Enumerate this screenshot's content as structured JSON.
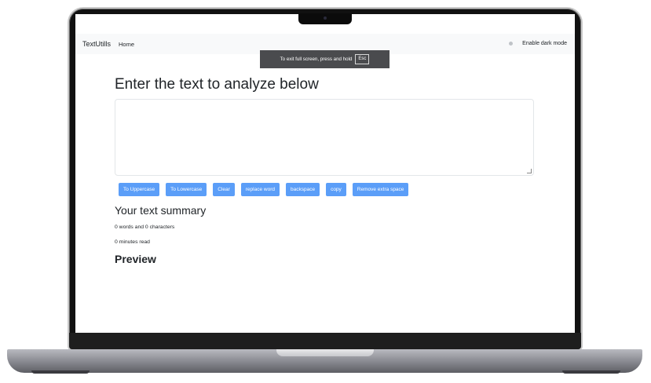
{
  "navbar": {
    "brand": "TextUtills",
    "home_label": "Home",
    "dark_mode_label": "Enable dark mode"
  },
  "fullscreen_hint": {
    "text": "To exit full screen, press and hold",
    "key": "Esc"
  },
  "main": {
    "heading": "Enter the text to analyze below",
    "textarea_value": "",
    "buttons": [
      "To Uppercase",
      "To Lowercase",
      "Clear",
      "replace word",
      "backspace",
      "copy",
      "Remove extra space"
    ]
  },
  "summary": {
    "heading": "Your text summary",
    "words_chars": "0 words and 0 characters",
    "read_time": "0 minutes read"
  },
  "preview": {
    "heading": "Preview"
  },
  "colors": {
    "button_bg": "#5b9ef8",
    "navbar_bg": "#f8f9fa",
    "hint_bg": "#4a4b4e"
  }
}
